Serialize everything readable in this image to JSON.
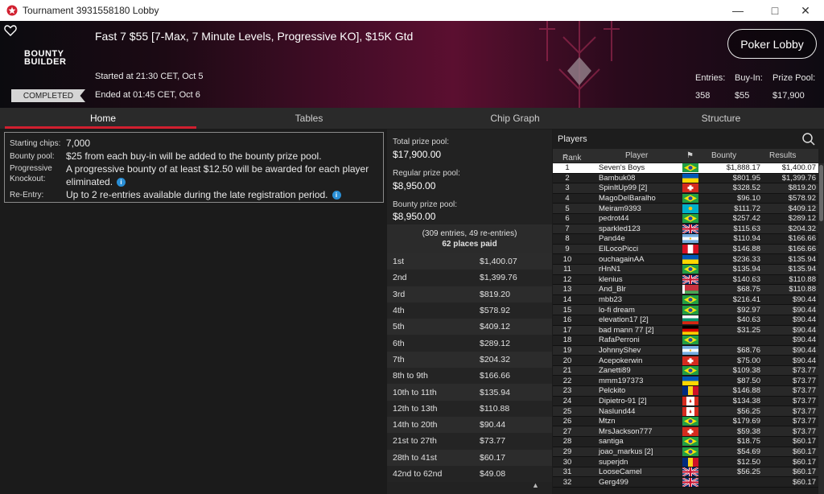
{
  "window": {
    "title": "Tournament 3931558180 Lobby"
  },
  "banner": {
    "title": "Fast 7 $55 [7-Max, 7 Minute Levels, Progressive KO], $15K Gtd",
    "logo_line1": "BOUNTY",
    "logo_line2": "BUILDER",
    "started": "Started at 21:30 CET, Oct 5",
    "ended": "Ended at 01:45 CET, Oct 6",
    "status": "COMPLETED",
    "lobby_button": "Poker Lobby",
    "stats": {
      "entries_label": "Entries:",
      "entries_value": "358",
      "buyin_label": "Buy-In:",
      "buyin_value": "$55",
      "prizepool_label": "Prize Pool:",
      "prizepool_value": "$17,900"
    }
  },
  "tabs": [
    "Home",
    "Tables",
    "Chip Graph",
    "Structure"
  ],
  "info": [
    {
      "key": "Starting chips:",
      "value": "7,000",
      "icon": false
    },
    {
      "key": "Bounty pool:",
      "value": "$25 from each buy-in will be added to the bounty prize pool.",
      "icon": false
    },
    {
      "key": "Progressive Knockout:",
      "value": "A progressive bounty of at least $12.50 will be awarded for each player eliminated.",
      "icon": true
    },
    {
      "key": "Re-Entry:",
      "value": "Up to 2 re-entries available during the late registration period.",
      "icon": true
    }
  ],
  "prize": {
    "total_label": "Total prize pool:",
    "total_value": "$17,900.00",
    "regular_label": "Regular prize pool:",
    "regular_value": "$8,950.00",
    "bounty_label": "Bounty prize pool:",
    "bounty_value": "$8,950.00",
    "entries_line": "(309 entries, 49 re-entries)",
    "paid_line": "62 places paid"
  },
  "payouts": [
    [
      "1st",
      "$1,400.07"
    ],
    [
      "2nd",
      "$1,399.76"
    ],
    [
      "3rd",
      "$819.20"
    ],
    [
      "4th",
      "$578.92"
    ],
    [
      "5th",
      "$409.12"
    ],
    [
      "6th",
      "$289.12"
    ],
    [
      "7th",
      "$204.32"
    ],
    [
      "8th to 9th",
      "$166.66"
    ],
    [
      "10th to 11th",
      "$135.94"
    ],
    [
      "12th to 13th",
      "$110.88"
    ],
    [
      "14th to 20th",
      "$90.44"
    ],
    [
      "21st to 27th",
      "$73.77"
    ],
    [
      "28th to 41st",
      "$60.17"
    ],
    [
      "42nd to 62nd",
      "$49.08"
    ]
  ],
  "players": {
    "title": "Players",
    "columns": {
      "rank": "Rank",
      "player": "Player",
      "bounty": "Bounty",
      "results": "Results"
    },
    "rows": [
      [
        "1",
        "Seven's Boys",
        "br",
        "$1,888.17",
        "$1,400.07"
      ],
      [
        "2",
        "Bambuk08",
        "ua",
        "$801.95",
        "$1,399.76"
      ],
      [
        "3",
        "SpinItUp99 [2]",
        "ch",
        "$328.52",
        "$819.20"
      ],
      [
        "4",
        "MagoDelBaralho",
        "br",
        "$96.10",
        "$578.92"
      ],
      [
        "5",
        "Meiram9393",
        "kz",
        "$111.72",
        "$409.12"
      ],
      [
        "6",
        "pedrot44",
        "br",
        "$257.42",
        "$289.12"
      ],
      [
        "7",
        "sparkled123",
        "gb",
        "$115.63",
        "$204.32"
      ],
      [
        "8",
        "Pand4e",
        "ar",
        "$110.94",
        "$166.66"
      ],
      [
        "9",
        "ElLocoPicci",
        "pe",
        "$146.88",
        "$166.66"
      ],
      [
        "10",
        "ouchagainAA",
        "ua",
        "$236.33",
        "$135.94"
      ],
      [
        "11",
        "rHnN1",
        "br",
        "$135.94",
        "$135.94"
      ],
      [
        "12",
        "klenius",
        "gb",
        "$140.63",
        "$110.88"
      ],
      [
        "13",
        "And_Blr",
        "by",
        "$68.75",
        "$110.88"
      ],
      [
        "14",
        "mbb23",
        "br",
        "$216.41",
        "$90.44"
      ],
      [
        "15",
        "lo-fi dream",
        "br",
        "$92.97",
        "$90.44"
      ],
      [
        "16",
        "elevation17 [2]",
        "bg",
        "$40.63",
        "$90.44"
      ],
      [
        "17",
        "bad mann 77 [2]",
        "de",
        "$31.25",
        "$90.44"
      ],
      [
        "18",
        "RafaPerroni",
        "br",
        "",
        "$90.44"
      ],
      [
        "19",
        "JohnnyShev",
        "ar",
        "$68.76",
        "$90.44"
      ],
      [
        "20",
        "Acepokerwin",
        "ch",
        "$75.00",
        "$90.44"
      ],
      [
        "21",
        "Zanetti89",
        "br",
        "$109.38",
        "$73.77"
      ],
      [
        "22",
        "mmm197373",
        "ua",
        "$87.50",
        "$73.77"
      ],
      [
        "23",
        "Pelckito",
        "ro",
        "$146.88",
        "$73.77"
      ],
      [
        "24",
        "Dipietro-91 [2]",
        "ca",
        "$134.38",
        "$73.77"
      ],
      [
        "25",
        "Naslund44",
        "ca",
        "$56.25",
        "$73.77"
      ],
      [
        "26",
        "Mtzn",
        "br",
        "$179.69",
        "$73.77"
      ],
      [
        "27",
        "MrsJackson777",
        "ch",
        "$59.38",
        "$73.77"
      ],
      [
        "28",
        "santiga",
        "br",
        "$18.75",
        "$60.17"
      ],
      [
        "29",
        "joao_markus [2]",
        "br",
        "$54.69",
        "$60.17"
      ],
      [
        "30",
        "superjdn",
        "ro",
        "$12.50",
        "$60.17"
      ],
      [
        "31",
        "LooseCamel",
        "gb",
        "$56.25",
        "$60.17"
      ],
      [
        "32",
        "Gerg499",
        "gb",
        "",
        "$60.17"
      ]
    ]
  },
  "colors": {
    "accent": "#d11f2f",
    "info": "#2a8fd6"
  }
}
